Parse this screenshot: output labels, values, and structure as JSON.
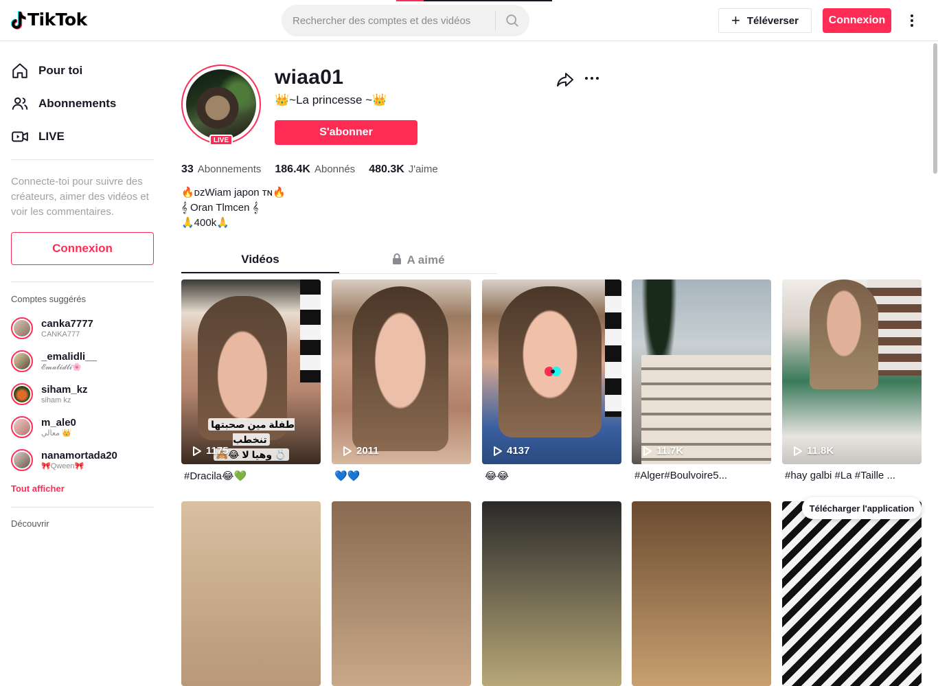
{
  "header": {
    "logo_text": "TikTok",
    "search_placeholder": "Rechercher des comptes et des vidéos",
    "upload_label": "Téléverser",
    "login_label": "Connexion"
  },
  "sidebar": {
    "nav": [
      {
        "label": "Pour toi",
        "icon": "home-icon"
      },
      {
        "label": "Abonnements",
        "icon": "users-icon"
      },
      {
        "label": "LIVE",
        "icon": "live-icon"
      }
    ],
    "login_prompt": "Connecte-toi pour suivre des créateurs, aimer des vidéos et voir les commentaires.",
    "login_button": "Connexion",
    "suggested_title": "Comptes suggérés",
    "suggested": [
      {
        "name": "canka7777",
        "sub": "CANKA777"
      },
      {
        "name": "_emalidli__",
        "sub": "𝓔𝓶𝓪𝓵𝓲𝓭𝓵𝓲🌸"
      },
      {
        "name": "siham_kz",
        "sub": "siham kz"
      },
      {
        "name": "m_ale0",
        "sub": "معالي 👑"
      },
      {
        "name": "nanamortada20",
        "sub": "🎀Qween🎀"
      }
    ],
    "see_all": "Tout afficher",
    "discover_title": "Découvrir"
  },
  "profile": {
    "username": "wiaa01",
    "nickname": "👑~La princesse ~👑",
    "live_badge": "LIVE",
    "follow_label": "S'abonner",
    "stats": [
      {
        "value": "33",
        "label": "Abonnements"
      },
      {
        "value": "186.4K",
        "label": "Abonnés"
      },
      {
        "value": "480.3K",
        "label": "J'aime"
      }
    ],
    "bio": [
      "🔥ᴅᴢWiam japon ᴛɴ🔥",
      "𝄞 Oran Tlmcen 𝄞",
      "🙏400k🙏"
    ]
  },
  "tabs": [
    {
      "label": "Vidéos",
      "active": true
    },
    {
      "label": "A aimé",
      "active": false,
      "icon": "lock-icon"
    }
  ],
  "videos": [
    {
      "views": "1175",
      "caption": "#Dracila😂💚",
      "overlay_line1": "طفلة مين صحبتها تنخطب",
      "overlay_line2": "🙈😂 وهيا لا 💍"
    },
    {
      "views": "2011",
      "caption": "💙💙"
    },
    {
      "views": "4137",
      "caption": "😂😂"
    },
    {
      "views": "11.7K",
      "caption": "#Alger#Boulvoire5..."
    },
    {
      "views": "11.8K",
      "caption": "#hay galbi #La #Taille ..."
    }
  ],
  "download_app": "Télécharger l'application",
  "colors": {
    "brand": "#fe2c55",
    "text": "#161823",
    "muted": "#8a8b91"
  }
}
